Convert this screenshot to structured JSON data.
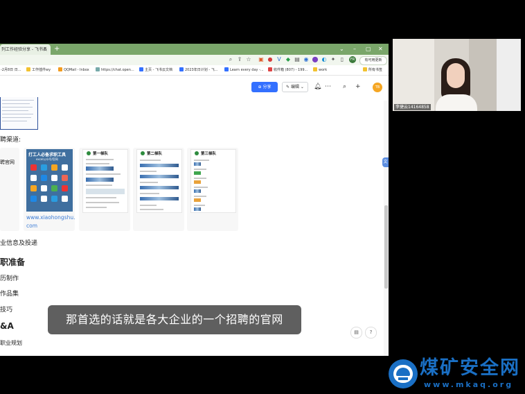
{
  "browser": {
    "tab_title": "列工作经验分享 - 飞书云",
    "tab_close": "×",
    "new_tab": "+",
    "window_controls": [
      "⌄",
      "–",
      "▢",
      "✕"
    ],
    "update_button": "有可用更新",
    "profile_initials": "FR",
    "bookmarks": [
      "-2月8日 日...",
      "工作插件wy",
      "QQMail - Inbox",
      "https://chat.open...",
      "主页 - 飞书云文档",
      "2023年日计划 - 飞...",
      "Learn every day -...",
      "收件箱 (807) - 199...",
      "work"
    ],
    "all_bookmarks": "所有书签"
  },
  "doc_toolbar": {
    "share_label": "分享",
    "edit_label": "编辑",
    "avatar": "TB"
  },
  "doc": {
    "channel_heading": "聘渠道:",
    "official_site_label": "聘官网",
    "poster": {
      "title_line1": "打工人必备求职工具",
      "title_line2": "excel公众号/官网",
      "url_line1": "www.xiaohongshu.",
      "url_line2": "com"
    },
    "sheets": [
      {
        "title": "第一梯队"
      },
      {
        "title": "第二梯队"
      },
      {
        "title": "第三梯队"
      }
    ],
    "section_info": "业信息及投递",
    "section_prep": "职准备",
    "item_resume": "历制作",
    "item_portfolio": "作品集",
    "item_tips": "技巧",
    "section_qa": "&A",
    "item_career": "职业规划"
  },
  "subtitle": "那首选的话就是各大企业的一个招聘的官网",
  "webcam": {
    "label": "李捷云14164858"
  },
  "watermark": {
    "title": "煤矿安全网",
    "url": "www.mkaq.org"
  }
}
